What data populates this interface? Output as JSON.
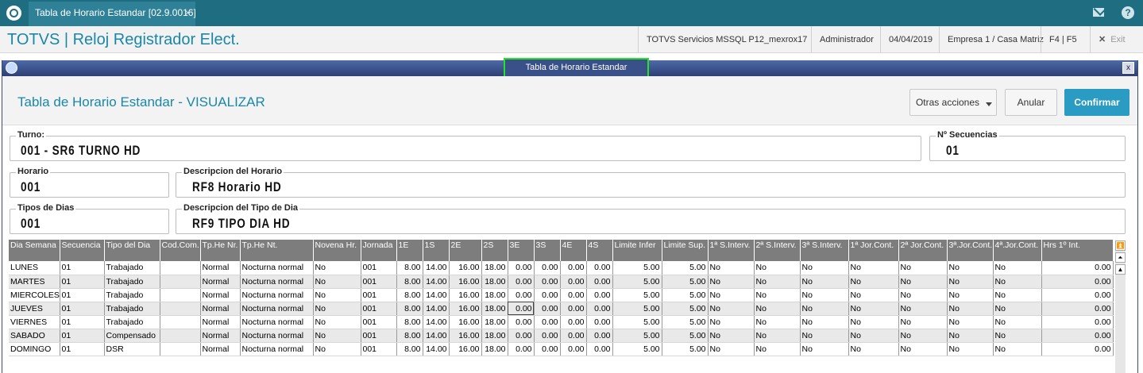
{
  "tabbar": {
    "tab_title": "Tabla de Horario Estandar [02.9.0016]",
    "tab_close": "×"
  },
  "header": {
    "app_title": "TOTVS | Reloj Registrador Elect.",
    "environment": "TOTVS Servicios MSSQL P12_mexrox17",
    "user": "Administrador",
    "date": "04/04/2019",
    "company": "Empresa 1 / Casa Matriz",
    "shortcuts": "F4 | F5",
    "exit_label": "Exit"
  },
  "window": {
    "caption": "Tabla de Horario Estandar",
    "close": "x",
    "form_title": "Tabla de Horario Estandar - VISUALIZAR",
    "otras_acciones": "Otras acciones",
    "anular": "Anular",
    "confirmar": "Confirmar"
  },
  "fields": {
    "turno_label": "Turno:",
    "turno_value": "001 - SR6 TURNO HD",
    "secuencias_label": "Nº Secuencias",
    "secuencias_value": "01",
    "horario_label": "Horario",
    "horario_value": "001",
    "desc_horario_label": "Descripcion del Horario",
    "desc_horario_value": "RF8 Horario HD",
    "tipos_dias_label": "Tipos de Dias",
    "tipos_dias_value": "001",
    "desc_tipo_label": "Descripcion del Tipo de Dia",
    "desc_tipo_value": "RF9 TIPO DIA HD"
  },
  "grid": {
    "columns": [
      "Dia Semana",
      "Secuencia",
      "Tipo del Dia",
      "Cod.Com.",
      "Tp.He Nr.",
      "Tp.He Nt.",
      "Novena Hr.",
      "Jornada",
      "1E",
      "1S",
      "2E",
      "2S",
      "3E",
      "3S",
      "4E",
      "4S",
      "Limite Infer",
      "Limite Sup.",
      "1ª S.Interv.",
      "2ª S.Interv.",
      "3ª S.Interv.",
      "1ª Jor.Cont.",
      "2ª Jor.Cont.",
      "3ª.Jor.Cont.",
      "4ª.Jor.Cont.",
      "Hrs 1º Int."
    ],
    "rows": [
      [
        "LUNES",
        "01",
        "Trabajado",
        "",
        "Normal",
        "Nocturna normal",
        "No",
        "001",
        "8.00",
        "14.00",
        "16.00",
        "18.00",
        "0.00",
        "0.00",
        "0.00",
        "0.00",
        "5.00",
        "5.00",
        "No",
        "No",
        "No",
        "No",
        "No",
        "No",
        "No",
        "0.00"
      ],
      [
        "MARTES",
        "01",
        "Trabajado",
        "",
        "Normal",
        "Nocturna normal",
        "No",
        "001",
        "8.00",
        "14.00",
        "16.00",
        "18.00",
        "0.00",
        "0.00",
        "0.00",
        "0.00",
        "5.00",
        "5.00",
        "No",
        "No",
        "No",
        "No",
        "No",
        "No",
        "No",
        "0.00"
      ],
      [
        "MIERCOLES",
        "01",
        "Trabajado",
        "",
        "Normal",
        "Nocturna normal",
        "No",
        "001",
        "8.00",
        "14.00",
        "16.00",
        "18.00",
        "0.00",
        "0.00",
        "0.00",
        "0.00",
        "5.00",
        "5.00",
        "No",
        "No",
        "No",
        "No",
        "No",
        "No",
        "No",
        "0.00"
      ],
      [
        "JUEVES",
        "01",
        "Trabajado",
        "",
        "Normal",
        "Nocturna normal",
        "No",
        "001",
        "8.00",
        "14.00",
        "16.00",
        "18.00",
        "0.00",
        "0.00",
        "0.00",
        "0.00",
        "5.00",
        "5.00",
        "No",
        "No",
        "No",
        "No",
        "No",
        "No",
        "No",
        "0.00"
      ],
      [
        "VIERNES",
        "01",
        "Trabajado",
        "",
        "Normal",
        "Nocturna normal",
        "No",
        "001",
        "8.00",
        "14.00",
        "16.00",
        "18.00",
        "0.00",
        "0.00",
        "0.00",
        "0.00",
        "5.00",
        "5.00",
        "No",
        "No",
        "No",
        "No",
        "No",
        "No",
        "No",
        "0.00"
      ],
      [
        "SABADO",
        "01",
        "Compensado",
        "",
        "Normal",
        "Nocturna normal",
        "No",
        "001",
        "8.00",
        "14.00",
        "16.00",
        "18.00",
        "0.00",
        "0.00",
        "0.00",
        "0.00",
        "5.00",
        "5.00",
        "No",
        "No",
        "No",
        "No",
        "No",
        "No",
        "No",
        "0.00"
      ],
      [
        "DOMINGO",
        "01",
        "DSR",
        "",
        "Normal",
        "Nocturna normal",
        "No",
        "001",
        "8.00",
        "14.00",
        "16.00",
        "18.00",
        "0.00",
        "0.00",
        "0.00",
        "0.00",
        "5.00",
        "5.00",
        "No",
        "No",
        "No",
        "No",
        "No",
        "No",
        "No",
        "0.00"
      ]
    ]
  },
  "icons": {
    "app_logo": "totvs-logo-icon",
    "mail": "mail-icon",
    "help": "help-icon",
    "exit": "close-icon",
    "scroll_top": "scroll-top-icon",
    "scroll_page_up": "scroll-page-up-icon",
    "scroll_up": "scroll-up-icon"
  },
  "colors": {
    "accent": "#1b87a8",
    "topbar": "#1f6d80",
    "confirm_button": "#2a9bc3",
    "caption_highlight": "#27e327",
    "grid_header": "#7d7d7d"
  }
}
